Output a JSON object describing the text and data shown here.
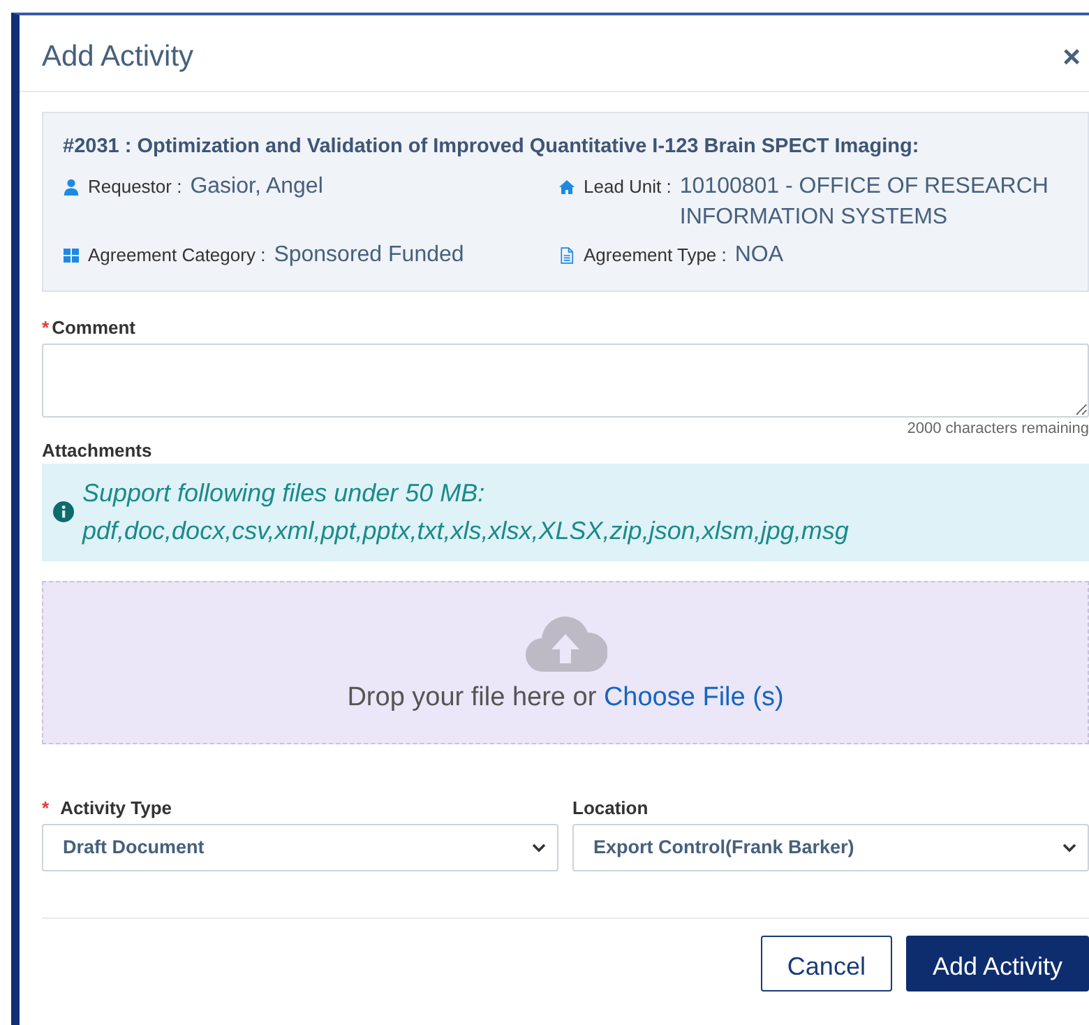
{
  "dialog": {
    "title": "Add Activity",
    "close": "×"
  },
  "summary": {
    "heading": "#2031 : Optimization and Validation of Improved Quantitative I-123 Brain SPECT Imaging:",
    "fields": [
      {
        "kind": "person",
        "label": "Requestor :",
        "value": "Gasior, Angel"
      },
      {
        "kind": "home",
        "label": "Lead Unit :",
        "value": "10100801 - OFFICE OF RESEARCH INFORMATION SYSTEMS"
      },
      {
        "kind": "grid",
        "label": "Agreement Category :",
        "value": "Sponsored Funded"
      },
      {
        "kind": "document",
        "label": "Agreement Type :",
        "value": "NOA"
      }
    ]
  },
  "required_mark": "*",
  "comment": {
    "label": "Comment",
    "required": true,
    "counter": "2000 characters remaining"
  },
  "attachments": {
    "label": "Attachments",
    "info_lines": [
      "Support following files under 50 MB:",
      "pdf,doc,docx,csv,xml,ppt,pptx,txt,xls,xlsx,XLSX,zip,json,xlsm,jpg,msg"
    ],
    "drop_text": "Drop your file here or",
    "choose_link": "Choose File (s)"
  },
  "selects": [
    {
      "label": "Activity Type",
      "required": true,
      "value": "Draft Document"
    },
    {
      "label": "Location",
      "required": false,
      "value": "Export Control(Frank Barker)"
    }
  ],
  "buttons": [
    {
      "label": "Cancel",
      "kind": "secondary"
    },
    {
      "label": "Add Activity",
      "kind": "primary"
    }
  ]
}
